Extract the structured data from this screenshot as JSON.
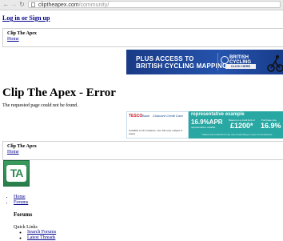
{
  "browser": {
    "url_host": "cliptheapex.com",
    "url_path": "/community/",
    "back_glyph": "←",
    "forward_glyph": "→",
    "reload_glyph": "↻"
  },
  "header": {
    "login_link": "Log in or Sign up"
  },
  "top_box": {
    "title": "Clip The Apex",
    "home_link": "Home"
  },
  "ad_cycling": {
    "line1": "PLUS ACCESS TO",
    "line2": "BRITISH CYCLING MAPPING",
    "brand_line1": "BRITISH",
    "brand_line2": "CYCLING",
    "cta": "CLICK HERE"
  },
  "main": {
    "heading": "Clip The Apex - Error",
    "message": "The requested page could not be found."
  },
  "ad_credit": {
    "brand": "TESCO",
    "brand_sub": "Bank",
    "product": "Clubcard Credit Card",
    "small_print": "Available to UK residents, over 18s only, subject to status.",
    "title": "representative example",
    "apr": "16.9%APR",
    "apr_sub": "representative variable",
    "based_on": "Based on a credit limit of",
    "amount": "£1200*",
    "fixed_label": "Purchase rate",
    "rate": "16.9%",
    "footnote": "* Rates and credit limit may vary depending on your circumstances"
  },
  "bottom_box": {
    "title": "Clip The Apex",
    "home_link": "Home"
  },
  "logo": {
    "text": "TA"
  },
  "nav": {
    "items": [
      "Home",
      "Forums"
    ]
  },
  "forums": {
    "heading": "Forums",
    "quick_links_label": "Quick Links",
    "quick_links": [
      "Search Forums",
      "Latest Threads"
    ]
  },
  "colors": {
    "link": "#00008b",
    "cycling_banner": "#1a3b86",
    "credit_banner": "#29a8a3",
    "logo_green": "#2d8a52"
  }
}
